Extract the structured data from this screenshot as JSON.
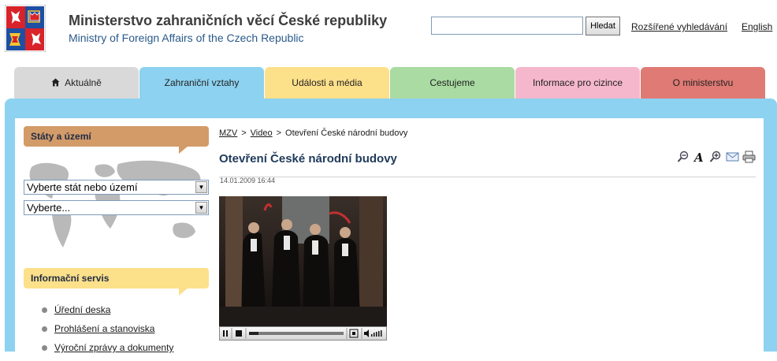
{
  "header": {
    "title_cz": "Ministerstvo zahraničních věcí České republiky",
    "title_en": "Ministry of Foreign Affairs of the Czech Republic",
    "search_button": "Hledat",
    "search_value": "",
    "advanced_search": "Rozšířené vyhledávání",
    "english_link": "English"
  },
  "tabs": [
    {
      "label": "Aktuálně",
      "color": "#d9d9d9"
    },
    {
      "label": "Zahraniční vztahy",
      "color": "#8dd2f0"
    },
    {
      "label": "Události a média",
      "color": "#fce08a"
    },
    {
      "label": "Cestujeme",
      "color": "#a9dba2"
    },
    {
      "label": "Informace pro cizince",
      "color": "#f5b7cc"
    },
    {
      "label": "O ministerstvu",
      "color": "#e07a74"
    }
  ],
  "sidebar": {
    "states_heading": "Státy a území",
    "select_country": "Vyberte stát nebo území",
    "select_other": "Vyberte...",
    "info_heading": "Informační servis",
    "links": [
      "Úřední deska",
      "Prohlášení a stanoviska",
      "Výroční zprávy a dokumenty"
    ]
  },
  "main": {
    "breadcrumb": [
      "MZV",
      "Video",
      "Otevření České národní budovy"
    ],
    "title": "Otevření České národní budovy",
    "date": "14.01.2009 16:44"
  },
  "colors": {
    "frame": "#8dd2f0",
    "states_heading_bg": "#d29b68",
    "info_heading_bg": "#fce08a",
    "title": "#1f3a5a"
  },
  "icons": [
    "zoom-out-icon",
    "font-size-icon",
    "zoom-in-icon",
    "email-icon",
    "print-icon"
  ]
}
